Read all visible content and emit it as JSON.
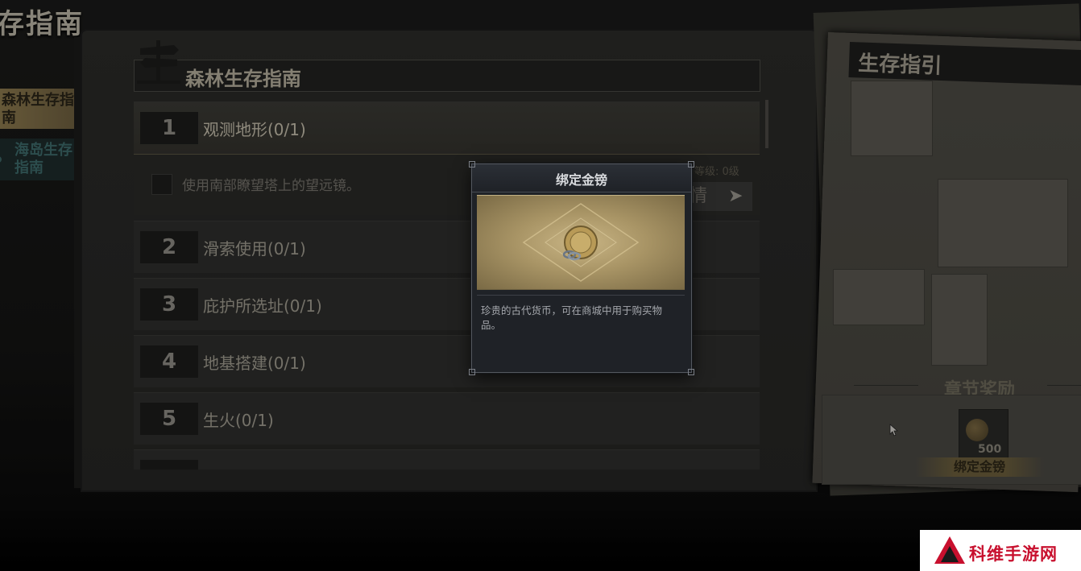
{
  "page": {
    "title": "存指南"
  },
  "tabs": [
    {
      "label": "森林生存指南",
      "active": true
    },
    {
      "label": "海岛生存指南",
      "active": false
    }
  ],
  "book": {
    "title": "森林生存指南"
  },
  "quests": [
    {
      "number": "1",
      "name": "观测地形(0/1)"
    },
    {
      "number": "2",
      "name": "滑索使用(0/1)"
    },
    {
      "number": "3",
      "name": "庇护所选址(0/1)"
    },
    {
      "number": "4",
      "name": "地基搭建(0/1)"
    },
    {
      "number": "5",
      "name": "生火(0/1)"
    }
  ],
  "quest_detail": {
    "task": "使用南部瞭望塔上的望远镜。",
    "level": "等级: 0级",
    "button": "情"
  },
  "guide": {
    "title": "生存指引",
    "reward_title": "章节奖励",
    "reward_item": {
      "name": "绑定金镑",
      "count": "500"
    }
  },
  "modal": {
    "title": "绑定金镑",
    "description": "珍贵的古代货币，可在商城中用于购买物品。"
  },
  "watermark": {
    "text": "科维手游网"
  },
  "colors": {
    "gold": "#b09a66",
    "modal_bg": "#1f2227",
    "watermark_red": "#c8102e"
  }
}
